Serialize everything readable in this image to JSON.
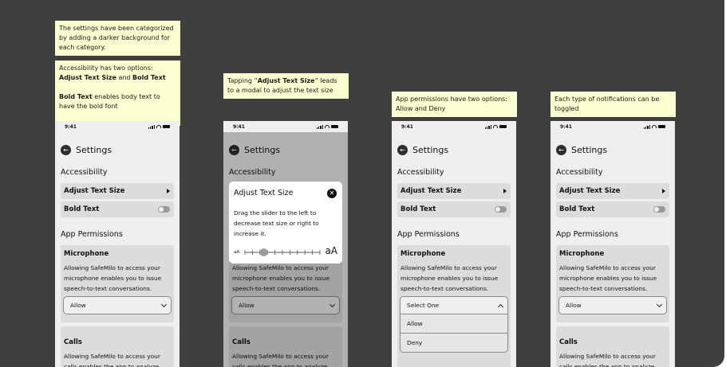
{
  "notes": {
    "n1": {
      "text": "The settings have been categorized by adding a darker background for each category."
    },
    "n2": {
      "p1_pre": "Accessibility has two options: ",
      "p1_b1": "Adjust Text Size",
      "p1_mid": " and ",
      "p1_b2": "Bold Text",
      "p2_b": "Bold Text",
      "p2_post": " enables body text to have the bold font"
    },
    "n3": {
      "pre": "Tapping “",
      "b": "Adjust Text Size",
      "post": "” leads to a modal to adjust the text size"
    },
    "n4": {
      "text": "App permissions have two options: Allow and Deny"
    },
    "n5": {
      "text": "Each type of notifications can be toggled"
    }
  },
  "phone": {
    "time": "9:41",
    "title": "Settings",
    "accessibility_heading": "Accessibility",
    "adjust_text_size": "Adjust Text Size",
    "bold_text": "Bold Text",
    "app_permissions_heading": "App Permissions",
    "microphone_title": "Microphone",
    "microphone_desc": "Allowing SafeMilo to access your microphone enables you to issue speech-to-text conversations.",
    "microphone_value": "Allow",
    "calls_title": "Calls",
    "calls_desc": "Allowing SafeMilo to access your calls enables the app to analyze",
    "select_placeholder": "Select One",
    "option_allow": "Allow",
    "option_deny": "Deny"
  },
  "modal": {
    "title": "Adjust Text Size",
    "body": "Drag the slider to the left to decrease text size or right to increase it.",
    "small_label": "aA",
    "large_label": "aA",
    "slider_value": 0.25
  },
  "colors": {
    "background": "#3f3f3f",
    "note": "#fcffcf",
    "phone": "#efefef",
    "card": "#dcdcdc"
  }
}
